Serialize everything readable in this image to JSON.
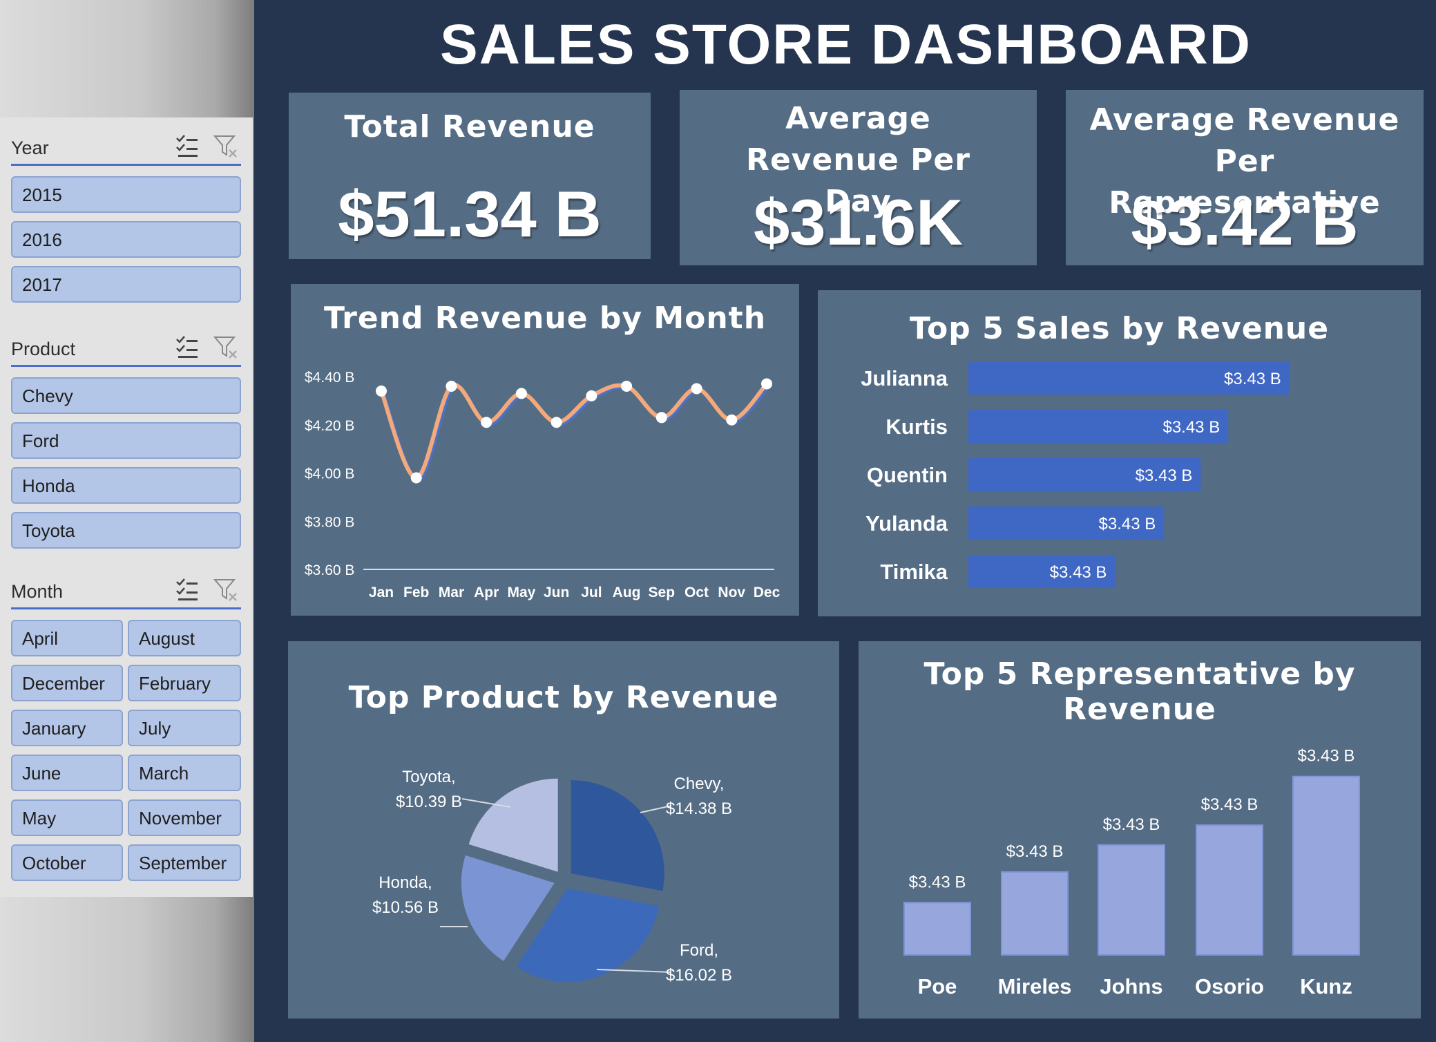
{
  "dashboard": {
    "title": "SALES STORE DASHBOARD",
    "kpis": [
      {
        "label": "Total Revenue",
        "value": "$51.34 B"
      },
      {
        "label": "Average Revenue Per Day",
        "value": "$31.6K"
      },
      {
        "label": "Average Revenue Per Representative",
        "value": "$3.42 B"
      }
    ],
    "panel_titles": {
      "trend": "Trend Revenue by Month",
      "top_sales": "Top 5 Sales by Revenue",
      "top_product": "Top Product by Revenue",
      "top_rep": "Top 5 Representative by Revenue"
    }
  },
  "slicers": {
    "year": {
      "title": "Year",
      "items": [
        "2015",
        "2016",
        "2017"
      ]
    },
    "product": {
      "title": "Product",
      "items": [
        "Chevy",
        "Ford",
        "Honda",
        "Toyota"
      ]
    },
    "month": {
      "title": "Month",
      "items": [
        "April",
        "August",
        "December",
        "February",
        "January",
        "July",
        "June",
        "March",
        "May",
        "November",
        "October",
        "September"
      ]
    }
  },
  "chart_data": [
    {
      "type": "line",
      "title": "Trend Revenue by Month",
      "categories": [
        "Jan",
        "Feb",
        "Mar",
        "Apr",
        "May",
        "Jun",
        "Jul",
        "Aug",
        "Sep",
        "Oct",
        "Nov",
        "Dec"
      ],
      "values": [
        4.34,
        3.98,
        4.36,
        4.21,
        4.33,
        4.21,
        4.32,
        4.36,
        4.23,
        4.35,
        4.22,
        4.37
      ],
      "yticks": [
        "$4.40 B",
        "$4.20 B",
        "$4.00 B",
        "$3.80 B",
        "$3.60 B"
      ],
      "ylim": [
        3.6,
        4.4
      ],
      "ylabel": "",
      "xlabel": "",
      "grid": false,
      "line_color": "#f4a97b",
      "line_shadow_color": "#4a72c8"
    },
    {
      "type": "bar",
      "orientation": "horizontal",
      "title": "Top 5 Sales by Revenue",
      "categories": [
        "Julianna",
        "Kurtis",
        "Quentin",
        "Yulanda",
        "Timika"
      ],
      "values": [
        3.4345,
        3.4325,
        3.4316,
        3.4304,
        3.4288
      ],
      "data_labels": [
        "$3.43 B",
        "$3.43 B",
        "$3.43 B",
        "$3.43 B",
        "$3.43 B"
      ],
      "xlim": [
        3.424,
        3.4355
      ],
      "bar_color": "#3f67c4"
    },
    {
      "type": "pie",
      "title": "Top Product by Revenue",
      "categories": [
        "Chevy",
        "Ford",
        "Honda",
        "Toyota"
      ],
      "values": [
        14.38,
        16.02,
        10.56,
        10.39
      ],
      "data_labels": [
        "Chevy, $14.38 B",
        "Ford, $16.02 B",
        "Honda, $10.56 B",
        "Toyota, $10.39 B"
      ],
      "colors": [
        "#2f579b",
        "#3d69ba",
        "#7b94d3",
        "#b4bfe1"
      ],
      "exploded": true
    },
    {
      "type": "bar",
      "orientation": "vertical",
      "title": "Top 5 Representative by Revenue",
      "categories": [
        "Poe",
        "Mireles",
        "Johns",
        "Osorio",
        "Kunz"
      ],
      "values": [
        3.4269,
        3.4286,
        3.4301,
        3.4312,
        3.4339
      ],
      "data_labels": [
        "$3.43 B",
        "$3.43 B",
        "$3.43 B",
        "$3.43 B",
        "$3.43 B"
      ],
      "ylim": [
        3.424,
        3.4345
      ],
      "bar_color": "#97a6dd"
    }
  ]
}
